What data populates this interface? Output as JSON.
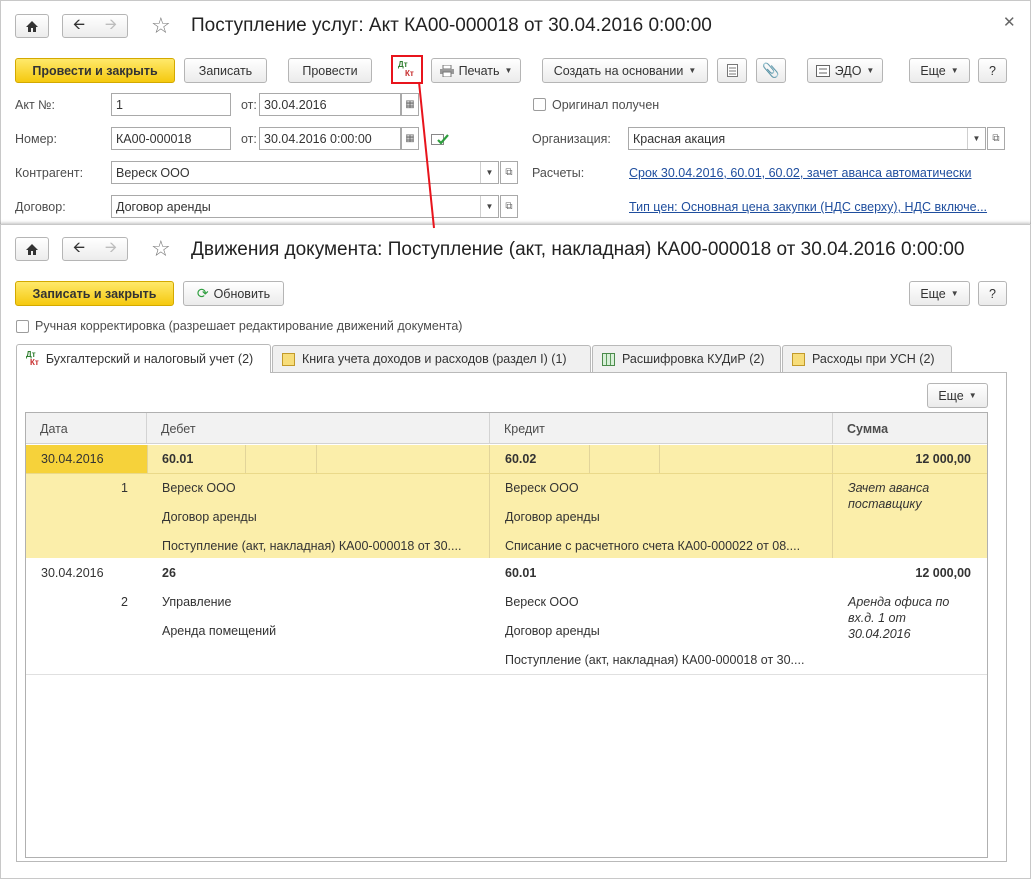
{
  "doc1": {
    "title": "Поступление услуг: Акт КА00-000018 от 30.04.2016 0:00:00",
    "buttons": {
      "post_close": "Провести и закрыть",
      "save": "Записать",
      "post": "Провести",
      "print": "Печать",
      "create_based": "Создать на основании",
      "edo": "ЭДО",
      "more": "Еще",
      "help": "?"
    },
    "fields": {
      "act_no_label": "Акт №:",
      "act_no": "1",
      "act_from_label": "от:",
      "act_date": "30.04.2016",
      "number_label": "Номер:",
      "number": "КА00-000018",
      "number_from_label": "от:",
      "number_date": "30.04.2016  0:00:00",
      "contractor_label": "Контрагент:",
      "contractor": "Вереск ООО",
      "contract_label": "Договор:",
      "contract": "Договор аренды",
      "original_label": "Оригинал получен",
      "org_label": "Организация:",
      "org": "Красная акация",
      "settlements_label": "Расчеты:",
      "settlements_link": "Срок 30.04.2016, 60.01, 60.02, зачет аванса автоматически",
      "price_type_link": "Тип цен: Основная цена закупки (НДС сверху), НДС включе..."
    },
    "dtkt_icon": {
      "top": "Дт",
      "bottom": "Кт"
    }
  },
  "doc2": {
    "title": "Движения документа: Поступление (акт, накладная) КА00-000018 от 30.04.2016 0:00:00",
    "buttons": {
      "save_close": "Записать и закрыть",
      "refresh": "Обновить",
      "more": "Еще",
      "help": "?",
      "grid_more": "Еще"
    },
    "manual_checkbox_label": "Ручная корректировка (разрешает редактирование движений документа)",
    "tabs": [
      {
        "label": "Бухгалтерский и налоговый учет (2)"
      },
      {
        "label": "Книга учета доходов и расходов (раздел I) (1)"
      },
      {
        "label": "Расшифровка КУДиР (2)"
      },
      {
        "label": "Расходы при УСН (2)"
      }
    ],
    "columns": [
      "Дата",
      "Дебет",
      "Кредит",
      "Сумма"
    ],
    "rows": [
      {
        "date": "30.04.2016",
        "num": "1",
        "debit_account": "60.01",
        "debit_sub": [
          "Вереск ООО",
          "Договор аренды",
          "Поступление (акт, накладная) КА00-000018 от 30...."
        ],
        "credit_account": "60.02",
        "credit_sub": [
          "Вереск ООО",
          "Договор аренды",
          "Списание с расчетного счета КА00-000022 от 08...."
        ],
        "amount": "12 000,00",
        "note": [
          "Зачет аванса",
          "поставщику"
        ]
      },
      {
        "date": "30.04.2016",
        "num": "2",
        "debit_account": "26",
        "debit_sub": [
          "Управление",
          "Аренда помещений"
        ],
        "credit_account": "60.01",
        "credit_sub": [
          "Вереск ООО",
          "Договор аренды",
          "Поступление (акт, накладная) КА00-000018 от 30...."
        ],
        "amount": "12 000,00",
        "note": [
          "Аренда офиса по",
          "вх.д. 1 от",
          "30.04.2016"
        ]
      }
    ]
  },
  "colors": {
    "primary_button": "#f5c90f",
    "selected_row": "#fbeeaa",
    "link": "#1f4e9e",
    "highlight_box": "#e8141c"
  }
}
